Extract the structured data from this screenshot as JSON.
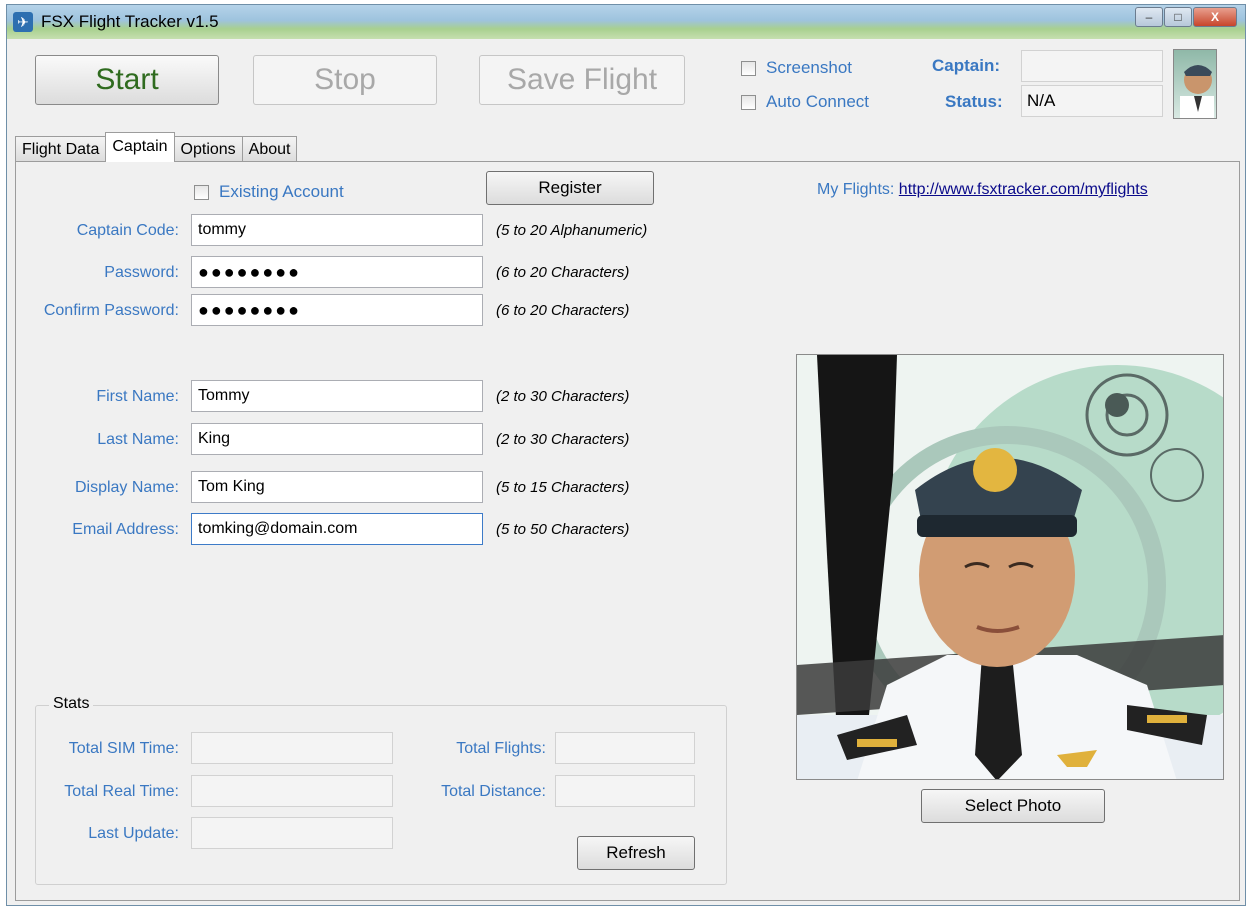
{
  "window": {
    "title": "FSX Flight Tracker v1.5",
    "controls": {
      "minimize": "–",
      "maximize": "□",
      "close": "X"
    }
  },
  "toolbar": {
    "start_label": "Start",
    "stop_label": "Stop",
    "save_label": "Save Flight",
    "screenshot_label": "Screenshot",
    "auto_connect_label": "Auto Connect",
    "captain_label": "Captain:",
    "captain_value": "",
    "status_label": "Status:",
    "status_value": "N/A"
  },
  "tabs": [
    {
      "label": "Flight Data",
      "active": false
    },
    {
      "label": "Captain",
      "active": true
    },
    {
      "label": "Options",
      "active": false
    },
    {
      "label": "About",
      "active": false
    }
  ],
  "captain": {
    "existing_account_label": "Existing Account",
    "register_label": "Register",
    "my_flights_label": "My Flights:",
    "my_flights_url": "http://www.fsxtracker.com/myflights",
    "fields": [
      {
        "label": "Captain Code:",
        "value": "tommy",
        "hint": "(5 to 20 Alphanumeric)"
      },
      {
        "label": "Password:",
        "value": "●●●●●●●●",
        "hint": "(6 to 20 Characters)"
      },
      {
        "label": "Confirm Password:",
        "value": "●●●●●●●●",
        "hint": "(6 to 20 Characters)"
      },
      {
        "label": "First Name:",
        "value": "Tommy",
        "hint": "(2 to 30 Characters)"
      },
      {
        "label": "Last Name:",
        "value": "King",
        "hint": "(2 to 30 Characters)"
      },
      {
        "label": "Display Name:",
        "value": "Tom King",
        "hint": "(5 to 15 Characters)"
      },
      {
        "label": "Email Address:",
        "value": "tomking@domain.com",
        "hint": "(5 to 50 Characters)"
      }
    ],
    "select_photo_label": "Select Photo"
  },
  "stats": {
    "title": "Stats",
    "total_sim_time_label": "Total SIM Time:",
    "total_real_time_label": "Total Real Time:",
    "last_update_label": "Last Update:",
    "total_flights_label": "Total Flights:",
    "total_distance_label": "Total Distance:",
    "refresh_label": "Refresh"
  },
  "icons": {
    "app": "airplane-icon",
    "avatar": "captain-avatar"
  },
  "colors": {
    "label_blue": "#3a78c2",
    "start_green": "#2f6b1f",
    "link": "#0a0a8a"
  }
}
